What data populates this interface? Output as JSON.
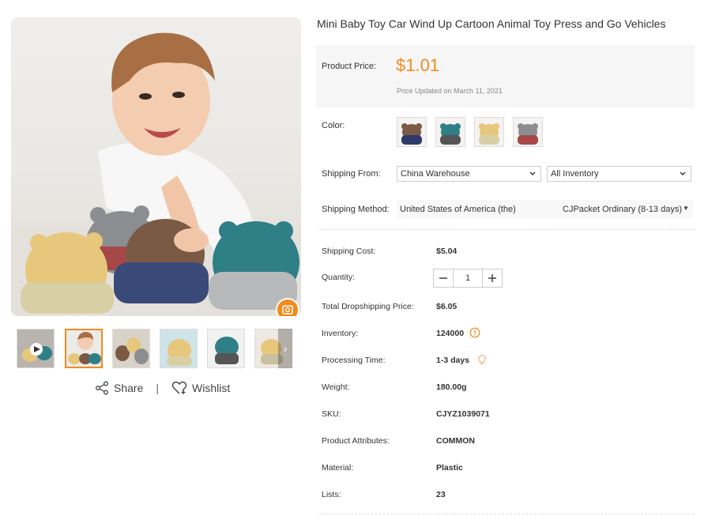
{
  "product": {
    "title": "Mini Baby Toy Car Wind Up Cartoon Animal Toy Press and Go Vehicles"
  },
  "price": {
    "label": "Product Price:",
    "value": "$1.01",
    "updated": "Price Updated on March 11, 2021"
  },
  "color": {
    "label": "Color:",
    "swatches": [
      {
        "name": "brown",
        "color": "#7a5a45"
      },
      {
        "name": "teal",
        "color": "#2f7f86"
      },
      {
        "name": "yellow",
        "color": "#e7c77c"
      },
      {
        "name": "gray",
        "color": "#8b8d90"
      }
    ]
  },
  "shipping_from": {
    "label": "Shipping From:",
    "warehouse": "China Warehouse",
    "inventory": "All Inventory"
  },
  "shipping_method": {
    "label": "Shipping Method:",
    "country": "United States of America (the)",
    "method": "CJPacket Ordinary (8-13 days)"
  },
  "details": {
    "shipping_cost_label": "Shipping Cost:",
    "shipping_cost": "$5.04",
    "quantity_label": "Quantity:",
    "quantity": "1",
    "total_label": "Total Dropshipping Price:",
    "total": "$6.05",
    "inventory_label": "Inventory:",
    "inventory": "124000",
    "processing_label": "Processing Time:",
    "processing": "1-3 days",
    "weight_label": "Weight:",
    "weight": "180.00g",
    "sku_label": "SKU:",
    "sku": "CJYZ1039071",
    "attributes_label": "Product Attributes:",
    "attributes": "COMMON",
    "material_label": "Material:",
    "material": "Plastic",
    "lists_label": "Lists:",
    "lists": "23"
  },
  "actions": {
    "share": "Share",
    "separator": "|",
    "wishlist": "Wishlist"
  },
  "colors": {
    "accent": "#f28a1d",
    "price_bg": "#f6f6f6"
  }
}
